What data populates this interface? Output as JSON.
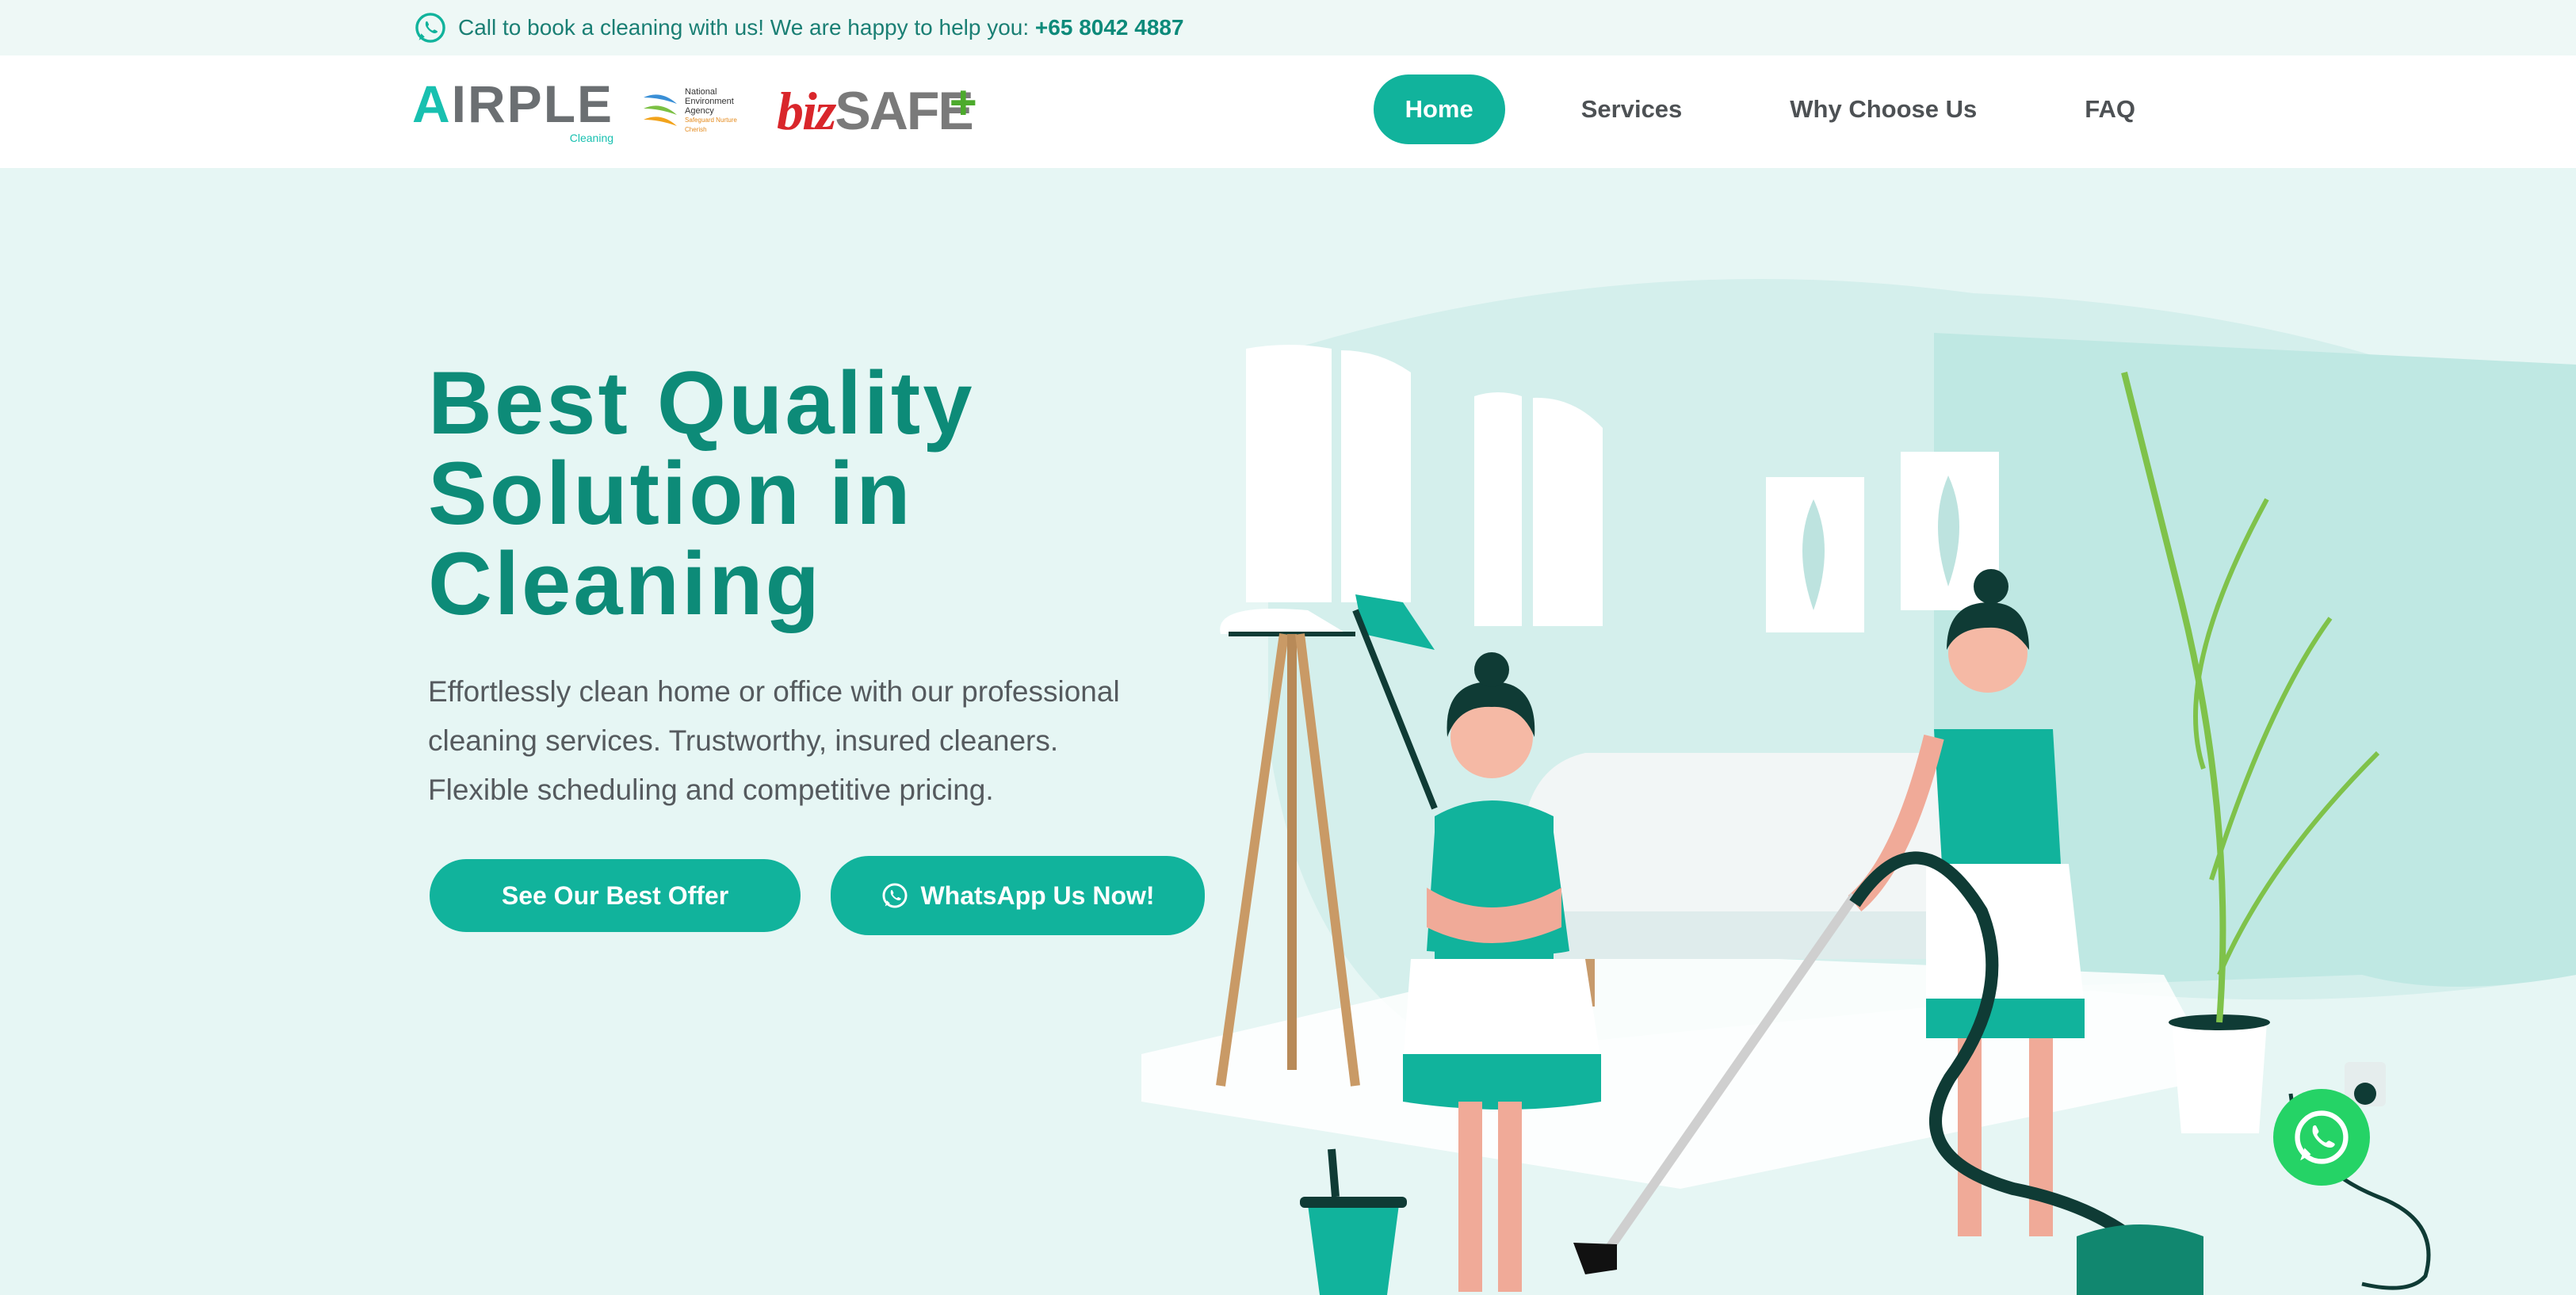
{
  "topbar": {
    "text": "Call to book a cleaning with us! We are happy to help you:",
    "phone": "+65 8042 4887"
  },
  "logos": {
    "brand_letter": "A",
    "brand_rest": "IRPLE",
    "brand_sub": "Cleaning",
    "nea_text": "National Environment Agency",
    "nea_tag": "Safeguard Nurture Cherish",
    "bizsafe_biz": "biz",
    "bizsafe_safe": "SAFE",
    "bizsafe_plus": "+"
  },
  "nav": {
    "items": [
      {
        "label": "Home",
        "active": true
      },
      {
        "label": "Services",
        "active": false
      },
      {
        "label": "Why Choose Us",
        "active": false
      },
      {
        "label": "FAQ",
        "active": false
      }
    ]
  },
  "hero": {
    "title_lines": [
      "Best Quality",
      "Solution in",
      "Cleaning"
    ],
    "description": "Effortlessly clean home or office with our professional cleaning services. Trustworthy,  insured cleaners. Flexible scheduling and competitive pricing.",
    "offer_button": "See Our Best Offer",
    "whatsapp_button": "WhatsApp Us Now!"
  },
  "icons": {
    "topbar": "whatsapp-icon",
    "button": "whatsapp-icon",
    "floating": "whatsapp-icon"
  },
  "colors": {
    "primary": "#11b39c",
    "title": "#0d8b78",
    "hero_bg": "#e6f6f4",
    "whatsapp": "#25d366"
  }
}
